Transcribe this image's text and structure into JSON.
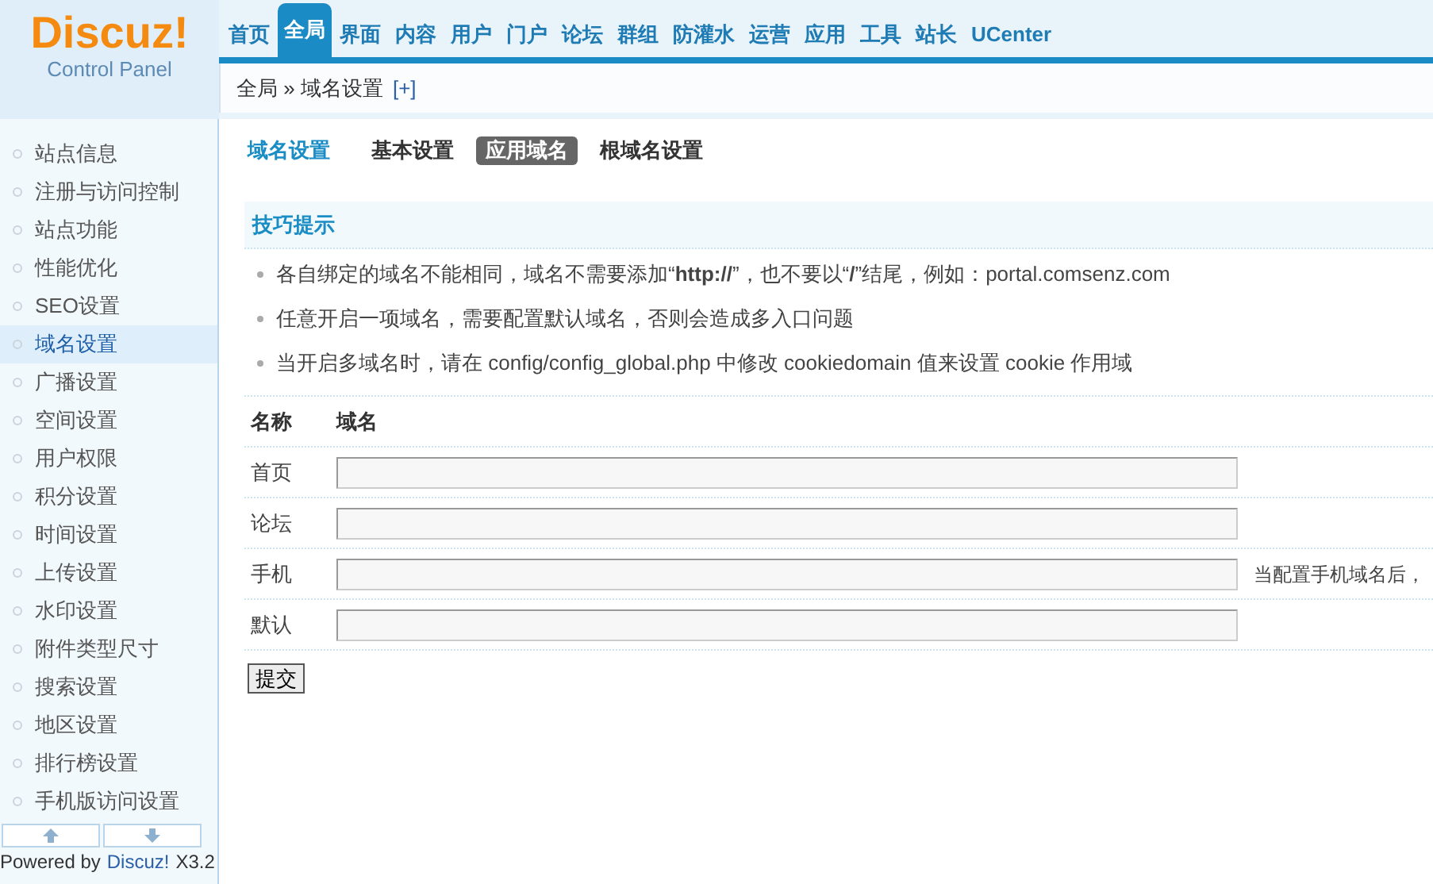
{
  "logo": {
    "title": "Discuz!",
    "subtitle": "Control Panel"
  },
  "nav": [
    {
      "label": "首页",
      "selected": false
    },
    {
      "label": "全局",
      "selected": true
    },
    {
      "label": "界面",
      "selected": false
    },
    {
      "label": "内容",
      "selected": false
    },
    {
      "label": "用户",
      "selected": false
    },
    {
      "label": "门户",
      "selected": false
    },
    {
      "label": "论坛",
      "selected": false
    },
    {
      "label": "群组",
      "selected": false
    },
    {
      "label": "防灌水",
      "selected": false
    },
    {
      "label": "运营",
      "selected": false
    },
    {
      "label": "应用",
      "selected": false
    },
    {
      "label": "工具",
      "selected": false
    },
    {
      "label": "站长",
      "selected": false
    },
    {
      "label": "UCenter",
      "selected": false
    }
  ],
  "breadcrumb": {
    "items": [
      "全局",
      "域名设置"
    ],
    "separator": "»",
    "add": "[+]"
  },
  "sidebar": {
    "items": [
      {
        "label": "站点信息",
        "selected": false
      },
      {
        "label": "注册与访问控制",
        "selected": false
      },
      {
        "label": "站点功能",
        "selected": false
      },
      {
        "label": "性能优化",
        "selected": false
      },
      {
        "label": "SEO设置",
        "selected": false
      },
      {
        "label": "域名设置",
        "selected": true
      },
      {
        "label": "广播设置",
        "selected": false
      },
      {
        "label": "空间设置",
        "selected": false
      },
      {
        "label": "用户权限",
        "selected": false
      },
      {
        "label": "积分设置",
        "selected": false
      },
      {
        "label": "时间设置",
        "selected": false
      },
      {
        "label": "上传设置",
        "selected": false
      },
      {
        "label": "水印设置",
        "selected": false
      },
      {
        "label": "附件类型尺寸",
        "selected": false
      },
      {
        "label": "搜索设置",
        "selected": false
      },
      {
        "label": "地区设置",
        "selected": false
      },
      {
        "label": "排行榜设置",
        "selected": false
      },
      {
        "label": "手机版访问设置",
        "selected": false
      }
    ],
    "footer": {
      "powered": "Powered by",
      "brand": "Discuz!",
      "version": "X3.2"
    }
  },
  "page_title": "域名设置",
  "tabs": [
    {
      "label": "基本设置",
      "selected": false
    },
    {
      "label": "应用域名",
      "selected": true
    },
    {
      "label": "根域名设置",
      "selected": false
    }
  ],
  "tips": {
    "title": "技巧提示",
    "items": [
      "各自绑定的域名不能相同，域名不需要添加“**http://**”，也不要以“**/**”结尾，例如：portal.comsenz.com",
      "任意开启一项域名，需要配置默认域名，否则会造成多入口问题",
      "当开启多域名时，请在 config/config_global.php 中修改 cookiedomain 值来设置 cookie 作用域"
    ]
  },
  "table": {
    "columns": [
      "名称",
      "域名"
    ],
    "rows": [
      {
        "name": "首页"
      },
      {
        "name": "论坛"
      },
      {
        "name": "手机",
        "note": "当配置手机域名后，"
      },
      {
        "name": "默认"
      }
    ]
  },
  "submit": "提交"
}
